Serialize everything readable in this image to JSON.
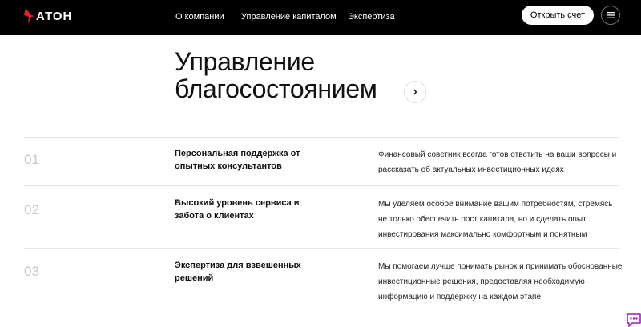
{
  "header": {
    "logo_text": "АТОН",
    "nav": [
      "О компании",
      "Управление капиталом",
      "Экспертиза"
    ],
    "open_account_label": "Открыть счет",
    "menu_icon": "hamburger-icon"
  },
  "main": {
    "title_line1": "Управление",
    "title_line2": "благосостоянием",
    "features": [
      {
        "num": "01",
        "title": "Персональная поддержка от опытных консультантов",
        "desc": "Финансовый советник всегда готов ответить на ваши вопросы и рассказать об актуальных инвестиционных идеях"
      },
      {
        "num": "02",
        "title": "Высокий уровень сервиса и забота о клиентах",
        "desc": "Мы уделяем особое внимание вашим потребностям, стремясь не только обеспечить рост капитала, но и сделать опыт инвестирования максимально комфортным и понятным"
      },
      {
        "num": "03",
        "title": "Экспертиза для взвешенных решений",
        "desc": "Мы помогаем лучше понимать рынок и принимать обоснованные инвестиционные решения, предоставляя необходимую информацию и поддержку на каждом этапе"
      }
    ]
  },
  "colors": {
    "header_bg": "#000000",
    "logo_accent": "#e5202e",
    "chat_accent": "#9b1fb8"
  }
}
